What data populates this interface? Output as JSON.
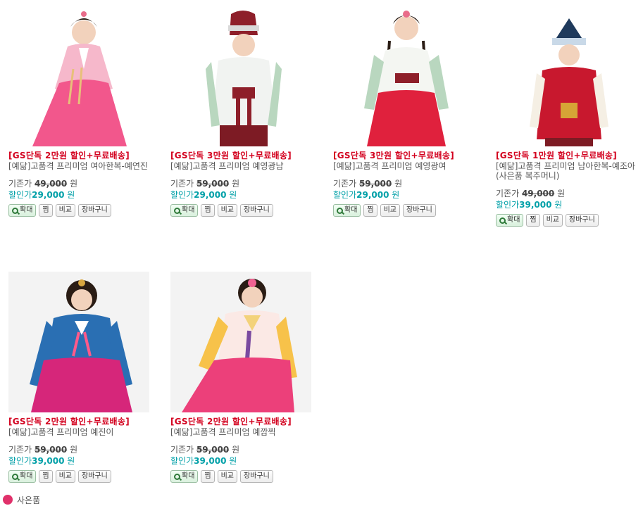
{
  "labels": {
    "orig_prefix": "기존가",
    "disc_prefix": "할인가",
    "won": "원",
    "zoom": "확대",
    "wish": "찜",
    "compare": "비교",
    "cart": "장바구니"
  },
  "products": [
    {
      "promo": "[GS단독 2만원 할인+무료배송]",
      "name": "[예닮]고품격 프리미엄 여아한복-예연진",
      "sub": "",
      "orig": "49,000",
      "disc": "29,000"
    },
    {
      "promo": "[GS단독 3만원 할인+무료배송]",
      "name": "[예닮]고품격 프리미엄 예영광남",
      "sub": "",
      "orig": "59,000",
      "disc": "29,000"
    },
    {
      "promo": "[GS단독 3만원 할인+무료배송]",
      "name": "[예닮]고품격 프리미엄 예영광여",
      "sub": "",
      "orig": "59,000",
      "disc": "29,000"
    },
    {
      "promo": "[GS단독 1만원 할인+무료배송]",
      "name": "[예닮]고품격 프리미엄 남아한복-예조아",
      "sub": "(사은품 복주머니)",
      "orig": "49,000",
      "disc": "39,000"
    },
    {
      "promo": "[GS단독 2만원 할인+무료배송]",
      "name": "[예닮]고품격 프리미엄 예진이",
      "sub": "",
      "orig": "59,000",
      "disc": "39,000"
    },
    {
      "promo": "[GS단독 2만원 할인+무료배송]",
      "name": "[예닮]고품격 프리미엄 예깜찍",
      "sub": "",
      "orig": "59,000",
      "disc": "39,000"
    }
  ],
  "footer": {
    "partial_text": "사은품"
  }
}
